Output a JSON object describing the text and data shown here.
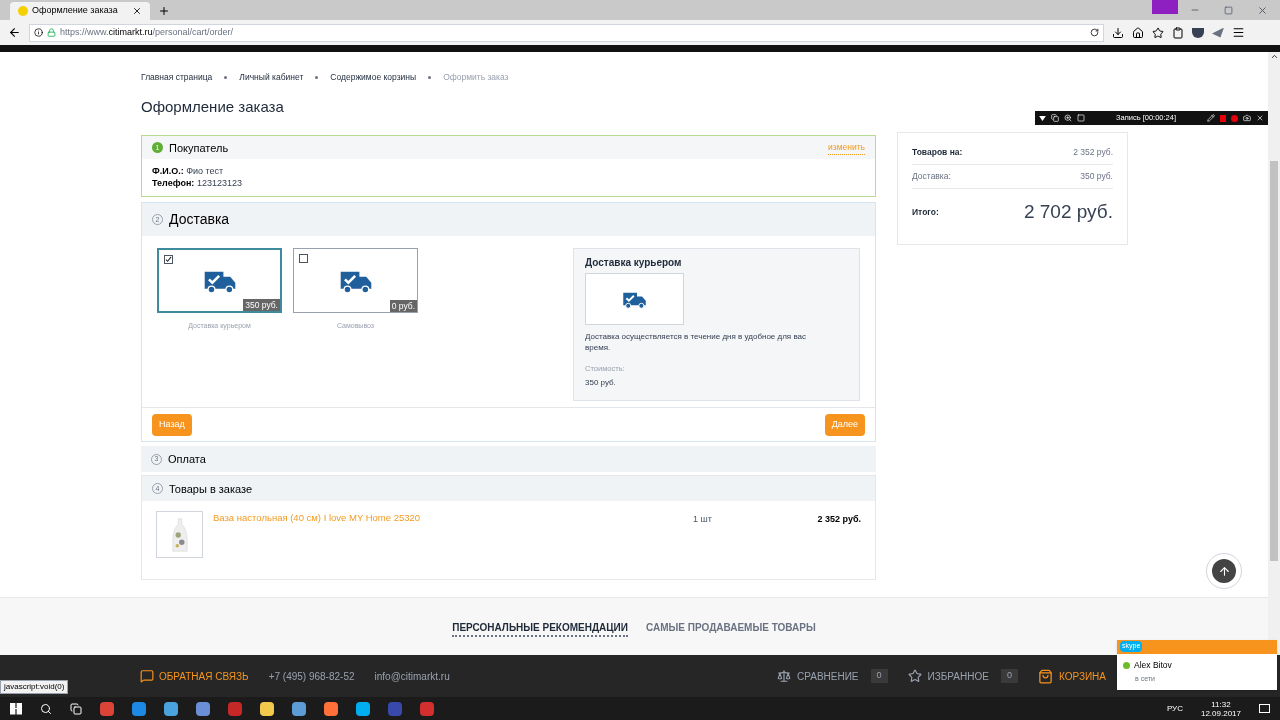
{
  "browser": {
    "tab_title": "Оформление заказа",
    "url_host": "https://www.",
    "url_domain": "citimarkt.ru",
    "url_path": "/personal/cart/order/"
  },
  "breadcrumbs": [
    {
      "label": "Главная страница",
      "current": false
    },
    {
      "label": "Личный кабинет",
      "current": false
    },
    {
      "label": "Содержимое корзины",
      "current": false
    },
    {
      "label": "Оформить заказ",
      "current": true
    }
  ],
  "page_title": "Оформление заказа",
  "buyer": {
    "step": "1",
    "title": "Покупатель",
    "edit_link": "изменить",
    "fields": [
      {
        "label": "Ф.И.О.:",
        "value": "Фио тест"
      },
      {
        "label": "Телефон:",
        "value": "123123123"
      }
    ]
  },
  "delivery": {
    "step": "2",
    "title": "Доставка",
    "options": [
      {
        "label": "Доставка курьером",
        "price": "350 руб.",
        "selected": true
      },
      {
        "label": "Самовывоз",
        "price": "0 руб.",
        "selected": false
      }
    ],
    "details": {
      "title": "Доставка курьером",
      "description": "Доставка осуществляется в течение дня в удобное для вас время.",
      "cost_label": "Стоимость:",
      "cost": "350 руб."
    },
    "back_button": "Назад",
    "next_button": "Далее"
  },
  "payment": {
    "step": "3",
    "title": "Оплата"
  },
  "items": {
    "step": "4",
    "title": "Товары в заказе",
    "rows": [
      {
        "name": "Ваза настольная (40 см) I love MY Home 25320",
        "quantity": "1 шт",
        "price": "2 352 руб."
      }
    ]
  },
  "summary": {
    "rows": [
      {
        "label": "Товаров на:",
        "value": "2 352 руб.",
        "kind": "bold"
      },
      {
        "label": "Доставка:",
        "value": "350 руб.",
        "kind": "muted"
      },
      {
        "label": "Итого:",
        "value": "2 702 руб.",
        "kind": "total"
      }
    ]
  },
  "recommendation_tabs": [
    {
      "label": "ПЕРСОНАЛЬНЫЕ РЕКОМЕНДАЦИИ",
      "selected": true
    },
    {
      "label": "САМЫЕ ПРОДАВАЕМЫЕ ТОВАРЫ",
      "selected": false
    }
  ],
  "footer": {
    "feedback": "ОБРАТНАЯ СВЯЗЬ",
    "phone": "+7 (495) 968-82-52",
    "email": "info@citimarkt.ru",
    "compare": "СРАВНЕНИЕ",
    "compare_count": "0",
    "favorites": "ИЗБРАННОЕ",
    "favorites_count": "0",
    "cart": "КОРЗИНА"
  },
  "status_link": "javascript:void(0)",
  "recorder": {
    "label": "Запись [00:00:24]"
  },
  "skype": {
    "brand": "skype",
    "name": "Alex Bitov",
    "status": "в сети"
  },
  "taskbar": {
    "language": "РУС",
    "time": "11:32",
    "date": "12.09.2017"
  }
}
